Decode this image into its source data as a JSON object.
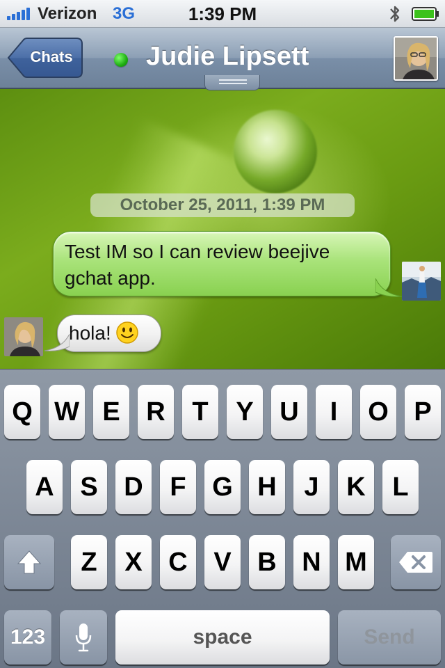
{
  "status_bar": {
    "carrier": "Verizon",
    "network": "3G",
    "time": "1:39 PM",
    "bluetooth_icon": "bluetooth-icon",
    "battery_icon": "battery-icon"
  },
  "nav": {
    "back_label": "Chats",
    "contact_name": "Judie Lipsett",
    "presence_color": "#1fae12"
  },
  "chat": {
    "timestamp": "October 25, 2011, 1:39 PM",
    "messages": [
      {
        "direction": "outgoing",
        "text": "Test IM so I can review beejive gchat app."
      },
      {
        "direction": "incoming",
        "text": "hola!",
        "emoji": "smiley-icon"
      }
    ]
  },
  "keyboard": {
    "row1": [
      "Q",
      "W",
      "E",
      "R",
      "T",
      "Y",
      "U",
      "I",
      "O",
      "P"
    ],
    "row2": [
      "A",
      "S",
      "D",
      "F",
      "G",
      "H",
      "J",
      "K",
      "L"
    ],
    "row3": [
      "Z",
      "X",
      "C",
      "V",
      "B",
      "N",
      "M"
    ],
    "shift_icon": "shift-icon",
    "delete_icon": "backspace-icon",
    "numbers_label": "123",
    "mic_icon": "microphone-icon",
    "space_label": "space",
    "send_label": "Send"
  }
}
